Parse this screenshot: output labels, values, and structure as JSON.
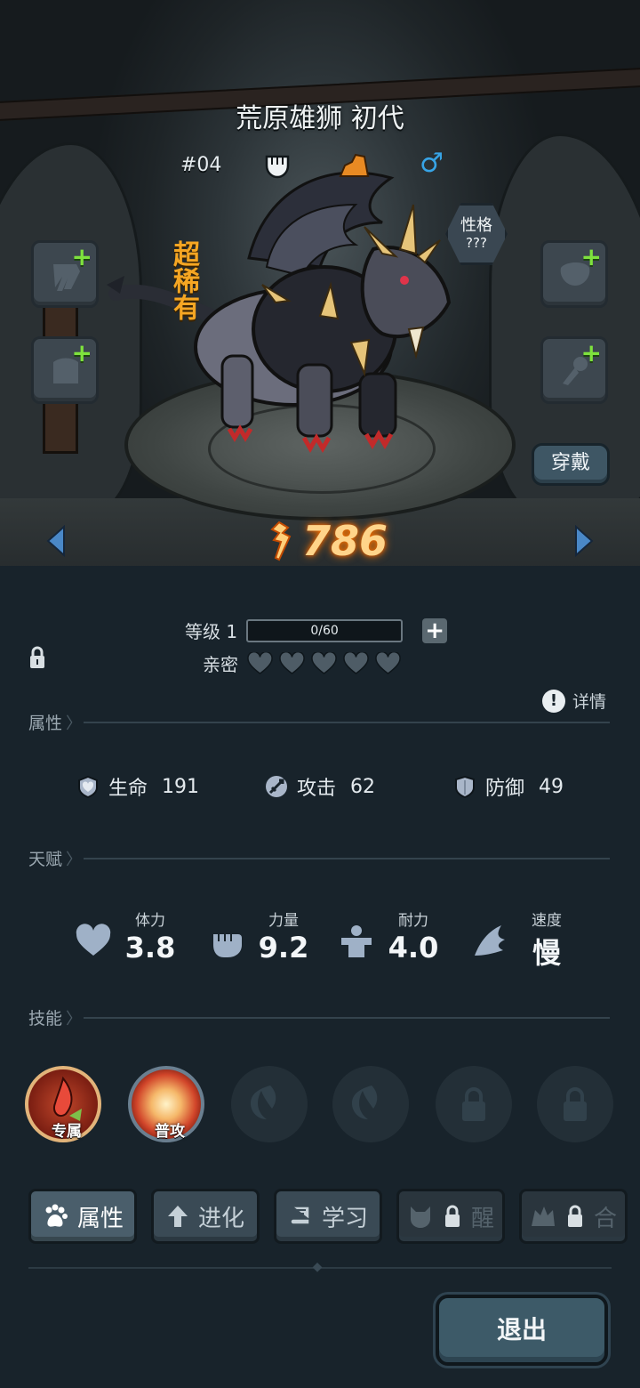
{
  "pet": {
    "name": "荒原雄狮 初代",
    "number": "#04",
    "rarity": "超稀有",
    "gender_symbol": "♂",
    "personality_label": "性格",
    "personality_value": "???",
    "power": "786"
  },
  "scene": {
    "wear_button": "穿戴",
    "equip_plus": "+"
  },
  "level": {
    "label": "等级 1",
    "xp": "0/60",
    "plus": "+"
  },
  "intimacy": {
    "label": "亲密",
    "hearts_filled": 0,
    "hearts_total": 5
  },
  "details_label": "详情",
  "details_icon": "!",
  "sections": {
    "attributes": "属性",
    "talent": "天赋",
    "skills": "技能"
  },
  "stats": [
    {
      "label": "生命",
      "value": "191",
      "icon": "heart-shield-icon"
    },
    {
      "label": "攻击",
      "value": "62",
      "icon": "sword-icon"
    },
    {
      "label": "防御",
      "value": "49",
      "icon": "shield-icon"
    }
  ],
  "talents": [
    {
      "label": "体力",
      "value": "3.8",
      "icon": "heart-icon"
    },
    {
      "label": "力量",
      "value": "9.2",
      "icon": "fist-icon"
    },
    {
      "label": "耐力",
      "value": "4.0",
      "icon": "muscle-icon"
    },
    {
      "label": "速度",
      "value": "慢",
      "icon": "wing-icon"
    }
  ],
  "skills": [
    {
      "caption": "专属",
      "state": "exclusive"
    },
    {
      "caption": "普攻",
      "state": "normal-attack"
    },
    {
      "caption": "",
      "state": "empty"
    },
    {
      "caption": "",
      "state": "empty"
    },
    {
      "caption": "",
      "state": "locked"
    },
    {
      "caption": "",
      "state": "locked"
    }
  ],
  "tabs": [
    {
      "label": "属性",
      "icon": "paw-icon",
      "active": true
    },
    {
      "label": "进化",
      "icon": "arrow-up-icon",
      "active": false
    },
    {
      "label": "学习",
      "icon": "book-icon",
      "active": false
    },
    {
      "label": "醒",
      "icon": "lock-icon",
      "active": false
    },
    {
      "label": "合",
      "icon": "lock-icon",
      "active": false
    }
  ],
  "exit_button": "退出",
  "colors": {
    "background": "#18232b",
    "rarity": "#f5a623",
    "gender": "#37a4e6",
    "power_glow": "#ff7a00",
    "equip_plus": "#7ee23d"
  }
}
